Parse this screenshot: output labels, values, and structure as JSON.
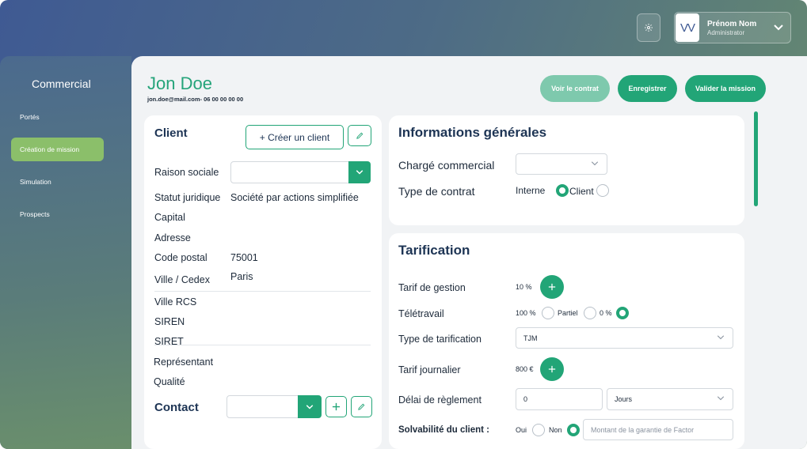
{
  "header": {
    "user_name": "Prénom Nom",
    "user_role": "Administrator",
    "avatar_initials": "VV"
  },
  "sidebar": {
    "title": "Commercial",
    "items": [
      {
        "label": "Portés",
        "active": false
      },
      {
        "label": "Création de mission",
        "active": true
      },
      {
        "label": "Simulation",
        "active": false
      },
      {
        "label": "Prospects",
        "active": false
      }
    ]
  },
  "person": {
    "name": "Jon Doe",
    "subtitle": "jon.doe@mail.com- 06 00 00 00 00"
  },
  "actions": {
    "view_contract": "Voir le contrat",
    "save": "Enregistrer",
    "validate": "Valider la mission"
  },
  "client": {
    "title": "Client",
    "create_label": "+ Créer un client",
    "fields": {
      "raison_sociale": "Raison sociale",
      "statut_juridique": "Statut juridique",
      "statut_juridique_value": "Société par actions simplifiée",
      "capital": "Capital",
      "adresse": "Adresse",
      "code_postal": "Code postal",
      "code_postal_value": "75001",
      "ville": "Ville / Cedex",
      "ville_value": "Paris",
      "ville_rcs": "Ville RCS",
      "siren": "SIREN",
      "siret": "SIRET",
      "representant": "Représentant",
      "qualite": "Qualité"
    },
    "contact_title": "Contact"
  },
  "general": {
    "title": "Informations générales",
    "charge_commercial": "Chargé commercial",
    "type_contrat": "Type de contrat",
    "option_interne": "Interne",
    "option_client": "Client"
  },
  "tarification": {
    "title": "Tarification",
    "tarif_gestion": "Tarif de gestion",
    "tarif_gestion_value": "10 %",
    "teletravail": "Télétravail",
    "tele_100": "100 %",
    "tele_partiel": "Partiel",
    "tele_0": "0 %",
    "type_tarification": "Type de tarification",
    "type_tarification_value": "TJM",
    "tarif_journalier": "Tarif journalier",
    "tarif_journalier_value": "800 €",
    "delai_reglement": "Délai de règlement",
    "delai_value": "0",
    "delai_unit": "Jours",
    "solvabilite": "Solvabilité du client :",
    "oui": "Oui",
    "non": "Non",
    "garantie_placeholder": "Montant de la garantie de Factor"
  },
  "colors": {
    "accent": "#22a577",
    "accent_light": "#7ec9ad",
    "active_nav": "#8bbf6a",
    "title_blue": "#1d3454"
  }
}
